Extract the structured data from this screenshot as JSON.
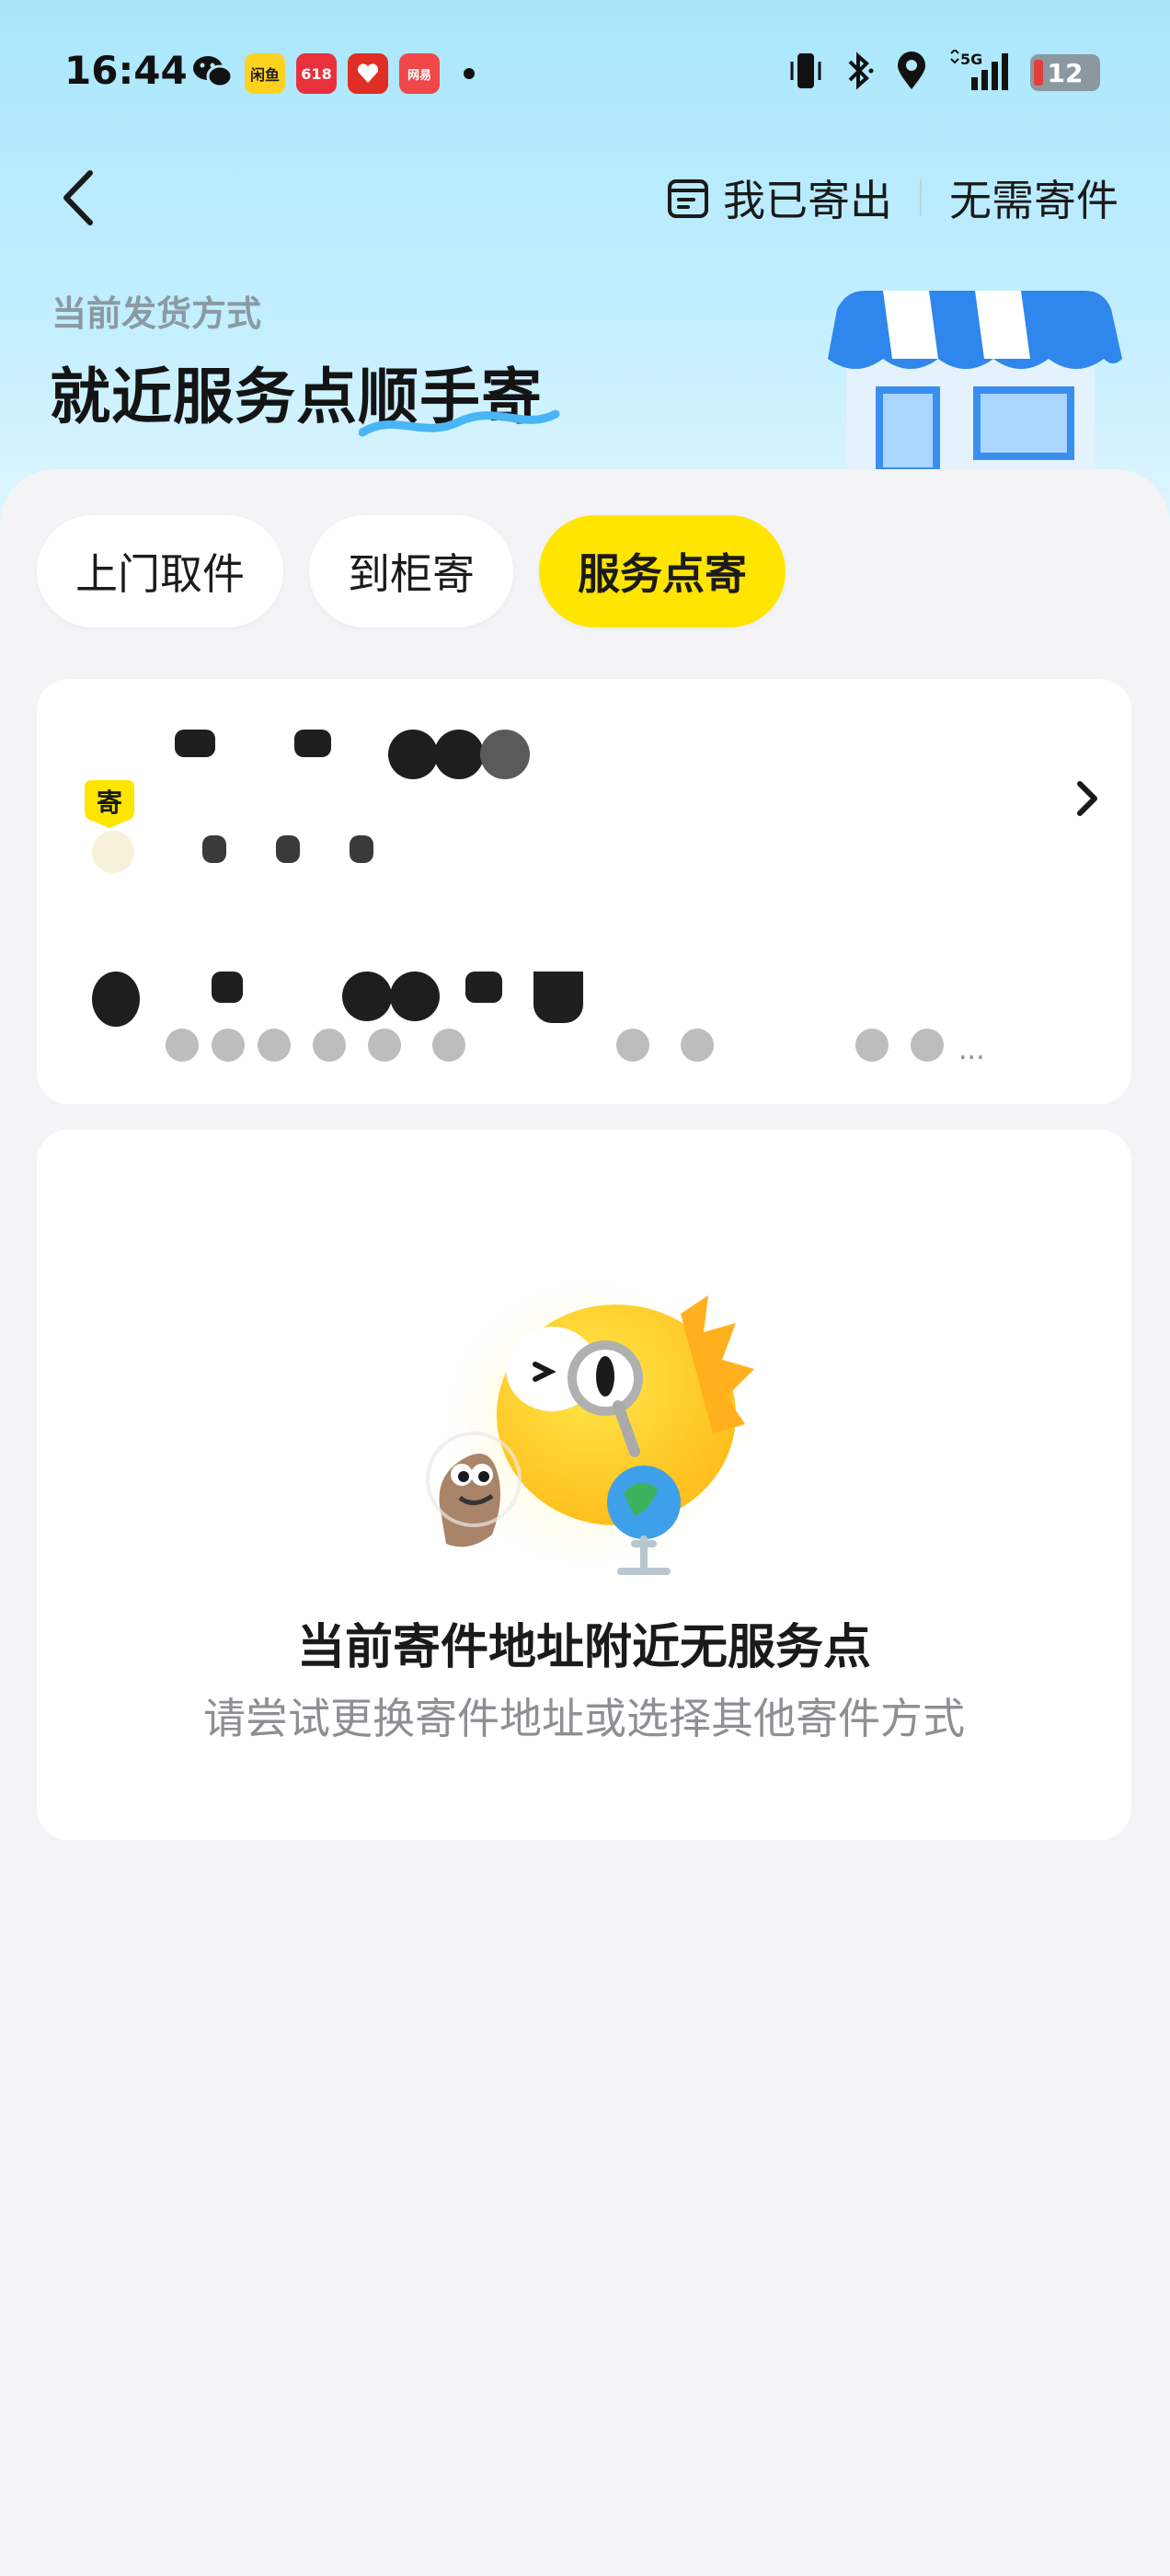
{
  "status_bar": {
    "time": "16:44",
    "notifications": [
      {
        "icon": "wechat-icon"
      },
      {
        "icon": "app-icon-yellow",
        "label": "闲鱼"
      },
      {
        "icon": "app-icon-618",
        "label": "618"
      },
      {
        "icon": "pinduoduo-icon"
      },
      {
        "icon": "app-icon-red",
        "label": "网易"
      }
    ],
    "network": "5G",
    "battery": "12"
  },
  "nav": {
    "sent_label": "我已寄出",
    "no_send_label": "无需寄件"
  },
  "header": {
    "current_label": "当前发货方式",
    "current_title": "就近服务点顺手寄"
  },
  "tabs": [
    {
      "label": "上门取件",
      "active": false
    },
    {
      "label": "到柜寄",
      "active": false
    },
    {
      "label": "服务点寄",
      "active": true
    }
  ],
  "address": {
    "badge": "寄"
  },
  "empty": {
    "title": "当前寄件地址附近无服务点",
    "subtitle": "请尝试更换寄件地址或选择其他寄件方式"
  },
  "colors": {
    "accent": "#ffe500",
    "header_bg": "#b6eafd",
    "page_bg": "#f4f4f6"
  }
}
